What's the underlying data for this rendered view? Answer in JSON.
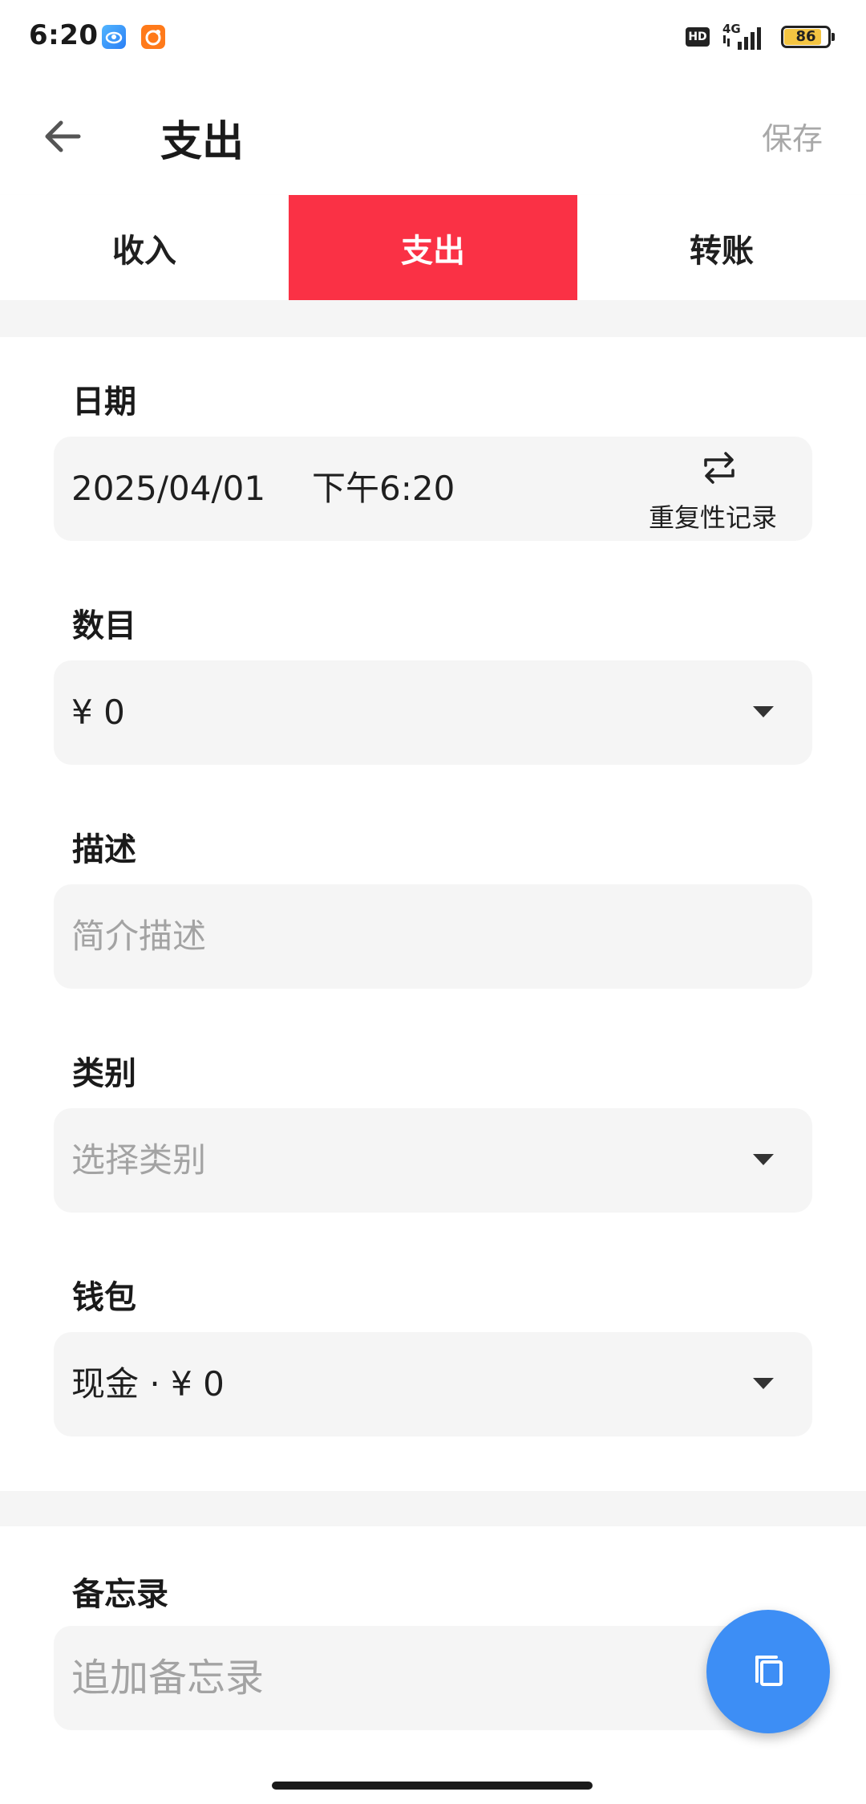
{
  "status_bar": {
    "time": "6:20",
    "hd_label": "HD",
    "network": "4G",
    "battery": "86",
    "battery_level": 0.86,
    "icons": [
      "app-icon-blue",
      "app-icon-orange",
      "hd-icon",
      "signal-icon",
      "battery-icon"
    ]
  },
  "app_bar": {
    "title": "支出",
    "save_label": "保存",
    "back_icon": "arrow-left-icon"
  },
  "tabs": [
    {
      "label": "收入",
      "active": false
    },
    {
      "label": "支出",
      "active": true
    },
    {
      "label": "转账",
      "active": false
    }
  ],
  "colors": {
    "accent": "#fa3145",
    "fab": "#3d8ef5",
    "field_bg": "#f5f5f5",
    "placeholder": "#a3a3a3"
  },
  "form": {
    "date": {
      "label": "日期",
      "date_value": "2025/04/01",
      "time_value": "下午6:20",
      "repeat_label": "重复性记录",
      "repeat_icon": "repeat-icon"
    },
    "amount": {
      "label": "数目",
      "value": "¥ 0"
    },
    "description": {
      "label": "描述",
      "placeholder": "简介描述"
    },
    "category": {
      "label": "类别",
      "placeholder": "选择类别"
    },
    "wallet": {
      "label": "钱包",
      "value": "现金 · ¥ 0"
    },
    "memo": {
      "label": "备忘录",
      "placeholder": "追加备忘录"
    }
  },
  "fab": {
    "icon": "copy-icon"
  }
}
